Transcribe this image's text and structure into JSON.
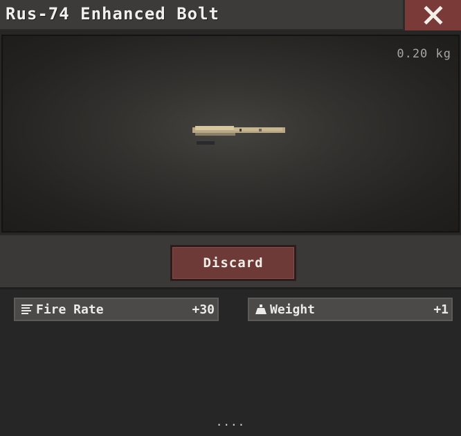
{
  "window": {
    "title": "Rus-74 Enhanced Bolt",
    "close_icon": "close-icon"
  },
  "item": {
    "weight": "0.20 kg",
    "image_icon": "bolt-item-icon"
  },
  "actions": {
    "discard_label": "Discard"
  },
  "stats": [
    {
      "icon": "fire-rate-icon",
      "label": "Fire Rate",
      "value": "+30"
    },
    {
      "icon": "weight-icon",
      "label": "Weight",
      "value": "+1"
    }
  ],
  "footer": {
    "more_indicator": "...."
  },
  "colors": {
    "close_button": "#7a3a37",
    "discard_button": "#6e3a37",
    "stat_background": "#4b4a48"
  }
}
